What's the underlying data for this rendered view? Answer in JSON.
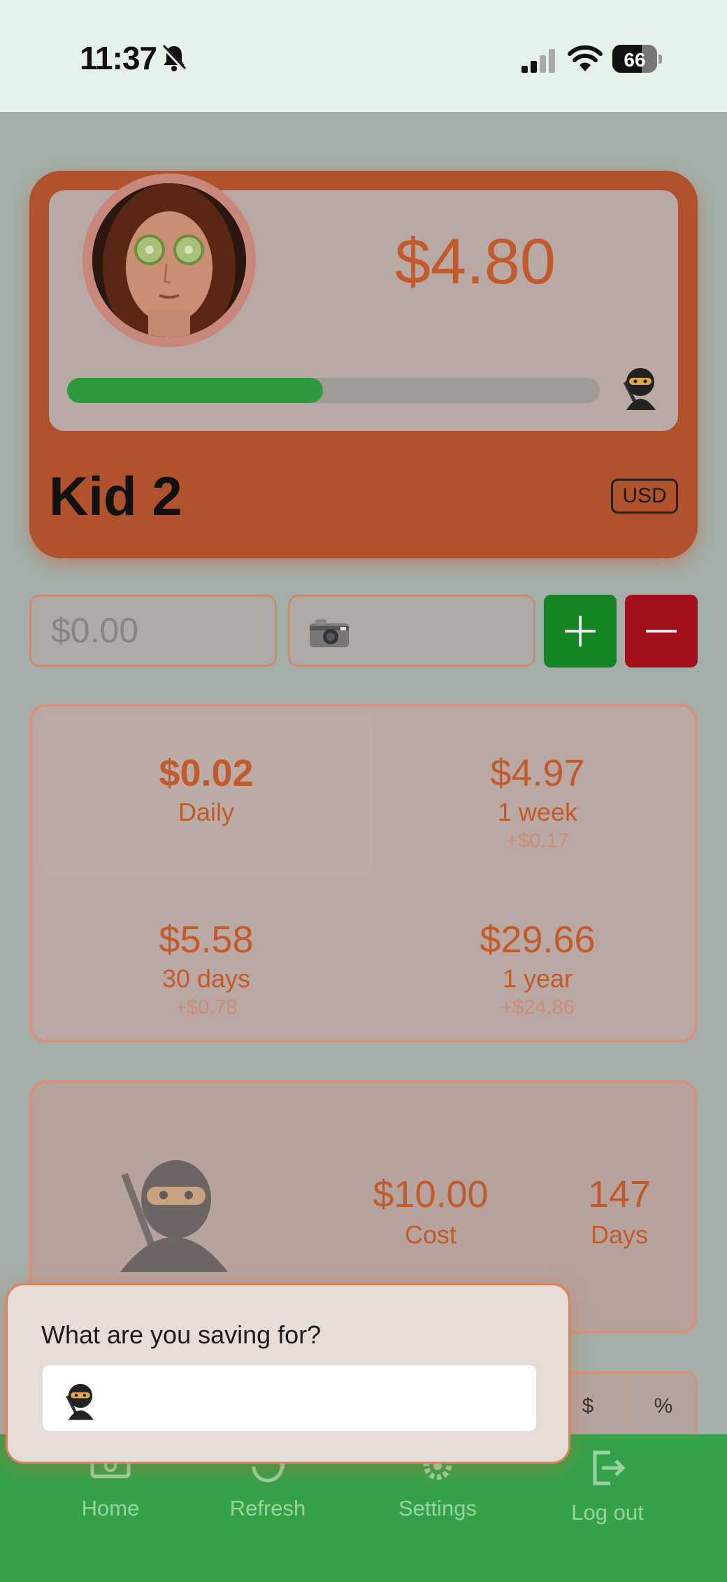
{
  "status_bar": {
    "time": "11:37",
    "battery": "66",
    "battery_level": 0.66,
    "icons": [
      "bell-slash-icon",
      "cellular-signal-icon",
      "wifi-icon",
      "battery-icon"
    ]
  },
  "kid": {
    "name": "Kid 2",
    "balance": "$4.80",
    "currency": "USD",
    "goal_progress": 0.48,
    "goal_emoji": "ninja"
  },
  "transaction": {
    "amount_placeholder": "$0.00",
    "photo_icon": "camera-icon",
    "add_icon": "plus-icon",
    "subtract_icon": "minus-icon"
  },
  "stats": [
    {
      "value": "$0.02",
      "label": "Daily",
      "delta": ""
    },
    {
      "value": "$4.97",
      "label": "1 week",
      "delta": "+$0.17"
    },
    {
      "value": "$5.58",
      "label": "30 days",
      "delta": "+$0.78"
    },
    {
      "value": "$29.66",
      "label": "1 year",
      "delta": "+$24.86"
    }
  ],
  "goal": {
    "emoji": "ninja",
    "cost": "$10.00",
    "cost_label": "Cost",
    "days": "147",
    "days_label": "Days"
  },
  "interest_toggle": {
    "options": [
      "$",
      "%"
    ]
  },
  "tabbar": {
    "items": [
      {
        "label": "Home",
        "icon": "money-icon"
      },
      {
        "label": "Refresh",
        "icon": "refresh-icon"
      },
      {
        "label": "Settings",
        "icon": "gear-icon"
      },
      {
        "label": "Log out",
        "icon": "logout-icon"
      }
    ]
  },
  "popover": {
    "question": "What are you saving for?",
    "input_value": "ninja"
  },
  "colors": {
    "accent": "#b0522b",
    "text_accent": "#c35a2a",
    "add": "#148424",
    "subtract": "#a30f1b",
    "tabbar": "#35a24a",
    "progress": "#2e9a3d"
  }
}
